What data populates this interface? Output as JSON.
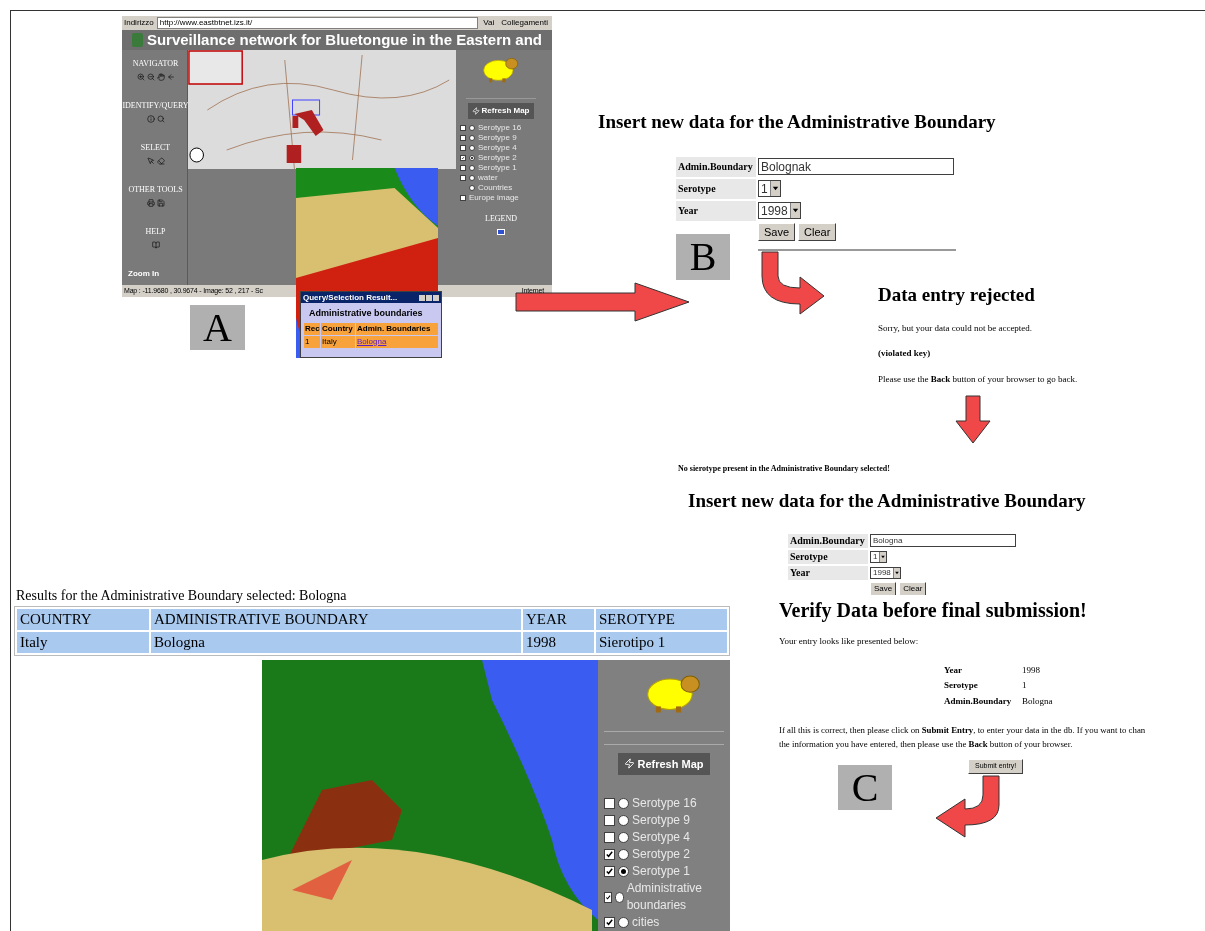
{
  "panel_a": {
    "address_bar": {
      "label": "Indirizzo",
      "url": "http://www.eastbtnet.izs.it/",
      "go": "Vai",
      "links": "Collegamenti"
    },
    "title": "Surveillance network for Bluetongue in the Eastern and",
    "tool_sections": [
      "NAVIGATOR",
      "IDENTIFY/QUERY",
      "SELECT",
      "OTHER TOOLS",
      "HELP"
    ],
    "mode": "Zoom In",
    "refresh": "Refresh Map",
    "layers": [
      {
        "kind": "check_radio",
        "label": "Serotype 16",
        "checked": false,
        "selected": false
      },
      {
        "kind": "check_radio",
        "label": "Serotype 9",
        "checked": false,
        "selected": false
      },
      {
        "kind": "check_radio",
        "label": "Serotype 4",
        "checked": false,
        "selected": false
      },
      {
        "kind": "check_radio",
        "label": "Serotype 2",
        "checked": true,
        "selected": true
      },
      {
        "kind": "check_radio",
        "label": "Serotype 1",
        "checked": false,
        "selected": false
      },
      {
        "kind": "check_radio",
        "label": "water",
        "checked": false,
        "selected": false
      },
      {
        "kind": "radio",
        "label": "Countries",
        "selected": false
      },
      {
        "kind": "check",
        "label": "Europe image",
        "checked": false
      }
    ],
    "legend": "LEGEND",
    "status": "Map : -11.9680 , 30.9674 - Image: 52 , 217 - Sc",
    "zone": "Internet",
    "popup": {
      "title": "Query/Selection Result...",
      "heading": "Administrative boundaries",
      "columns": [
        "Rec",
        "Country",
        "Admin. Boundaries"
      ],
      "row": [
        "1",
        "Italy",
        "Bologna"
      ]
    },
    "tag": "A"
  },
  "form_b": {
    "heading": "Insert new data for the Administrative Boundary",
    "fields": [
      {
        "kind": "text",
        "label": "Admin.Boundary",
        "value": "Bolognak"
      },
      {
        "kind": "select",
        "label": "Serotype",
        "value": "1"
      },
      {
        "kind": "select",
        "label": "Year",
        "value": "1998"
      }
    ],
    "buttons": [
      "Save",
      "Clear"
    ],
    "tag": "B"
  },
  "rejected": {
    "heading": "Data entry rejected",
    "lines": [
      "Sorry, but your data could not be accepted.",
      "**(violated key)**",
      "Please use the **Back** button of your browser to go back."
    ]
  },
  "form_c": {
    "notice": "No sierotype present in the Administrative Boundary selected!",
    "heading": "Insert new data for the Administrative Boundary",
    "fields": [
      {
        "kind": "text",
        "label": "Admin.Boundary",
        "value": "Bologna"
      },
      {
        "kind": "select",
        "label": "Serotype",
        "value": "1"
      },
      {
        "kind": "select",
        "label": "Year",
        "value": "1998"
      }
    ],
    "buttons": [
      "Save",
      "Clear"
    ]
  },
  "verify": {
    "heading": "Verify Data before final submission!",
    "intro": "Your entry looks like presented below:",
    "summary": [
      {
        "label": "Year",
        "value": "1998"
      },
      {
        "label": "Serotype",
        "value": "1"
      },
      {
        "label": "Admin.Boundary",
        "value": "Bologna"
      }
    ],
    "lines": [
      "If all this is correct, then please click on **Submit Entry**, to enter your data in the db. If you want to chan",
      "the information you have entered, then please use the **Back** button of your browser."
    ],
    "submit": "Submit entry!",
    "tag": "C"
  },
  "results": {
    "caption": "Results for the Administrative Boundary selected: Bologna",
    "columns": [
      "COUNTRY",
      "ADMINISTRATIVE BOUNDARY",
      "YEAR",
      "SEROTYPE"
    ],
    "row": [
      "Italy",
      "Bologna",
      "1998",
      "Sierotipo 1"
    ],
    "refresh": "Refresh Map",
    "layers": [
      {
        "kind": "check_radio",
        "label": "Serotype 16",
        "checked": false,
        "selected": false
      },
      {
        "kind": "check_radio",
        "label": "Serotype 9",
        "checked": false,
        "selected": false
      },
      {
        "kind": "check_radio",
        "label": "Serotype 4",
        "checked": false,
        "selected": false
      },
      {
        "kind": "check_radio",
        "label": "Serotype 2",
        "checked": true,
        "selected": false
      },
      {
        "kind": "check_radio",
        "label": "Serotype 1",
        "checked": true,
        "selected": true
      },
      {
        "kind": "check_radio",
        "label": "Administrative boundaries",
        "checked": true,
        "selected": false
      },
      {
        "kind": "check_radio",
        "label": "cities",
        "checked": true,
        "selected": false
      }
    ]
  }
}
